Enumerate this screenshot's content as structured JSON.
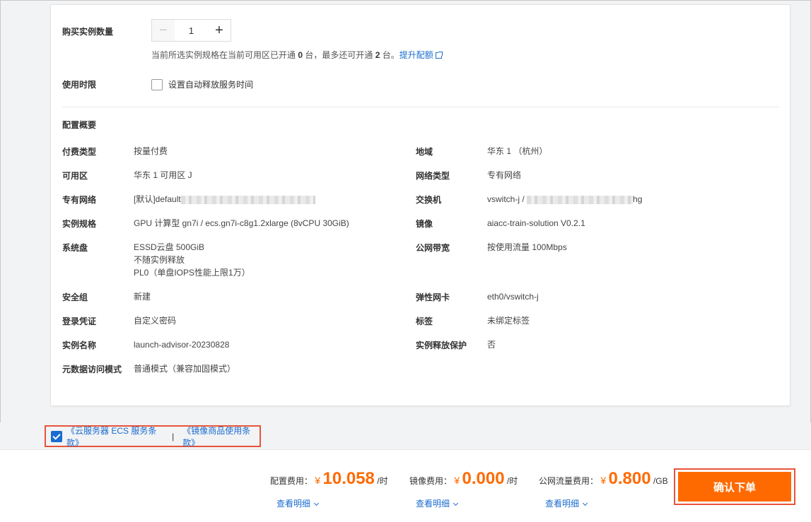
{
  "quantity": {
    "label": "购买实例数量",
    "minus": "−",
    "value": "1",
    "plus": "+",
    "hint_prefix": "当前所选实例规格在当前可用区已开通 ",
    "hint_count1": "0",
    "hint_mid": " 台，最多还可开通 ",
    "hint_count2": "2",
    "hint_suffix": " 台。",
    "hint_link": "提升配额"
  },
  "usage_time": {
    "label": "使用时限",
    "checkbox_label": "设置自动释放服务时间"
  },
  "summary": {
    "title": "配置概要",
    "pay_type": {
      "key": "付费类型",
      "value": "按量付费"
    },
    "region": {
      "key": "地域",
      "value": "华东 1 （杭州）"
    },
    "zone": {
      "key": "可用区",
      "value": "华东 1 可用区 J"
    },
    "network_type": {
      "key": "网络类型",
      "value": "专有网络"
    },
    "vpc": {
      "key": "专有网络",
      "value": "[默认]default"
    },
    "vswitch": {
      "key": "交换机",
      "value_prefix": "vswitch-j / ",
      "value_suffix": "hg"
    },
    "instance_type": {
      "key": "实例规格",
      "value": "GPU 计算型 gn7i / ecs.gn7i-c8g1.2xlarge (8vCPU 30GiB)"
    },
    "image": {
      "key": "镜像",
      "value": "aiacc-train-solution V0.2.1"
    },
    "system_disk": {
      "key": "系统盘",
      "line1": "ESSD云盘 500GiB",
      "line2": "不随实例释放",
      "line3": "PL0（单盘IOPS性能上限1万）"
    },
    "bandwidth": {
      "key": "公网带宽",
      "value": "按使用流量 100Mbps"
    },
    "security_group": {
      "key": "安全组",
      "value": "新建"
    },
    "eni": {
      "key": "弹性网卡",
      "value": "eth0/vswitch-j"
    },
    "login": {
      "key": "登录凭证",
      "value": "自定义密码"
    },
    "tags": {
      "key": "标签",
      "value": "未绑定标签"
    },
    "instance_name": {
      "key": "实例名称",
      "value": "launch-advisor-20230828"
    },
    "release_protect": {
      "key": "实例释放保护",
      "value": "否"
    },
    "metadata_mode": {
      "key": "元数据访问模式",
      "value": "普通模式（兼容加固模式）"
    }
  },
  "terms": {
    "ecs_terms": "《云服务器 ECS 服务条款》",
    "separator": "|",
    "image_terms": "《镜像商品使用条款》"
  },
  "footer": {
    "config_fee": {
      "label": "配置费用：",
      "currency": "¥",
      "amount": "10.058",
      "unit": "/时",
      "detail": "查看明细"
    },
    "image_fee": {
      "label": "镜像费用：",
      "currency": "¥",
      "amount": "0.000",
      "unit": "/时",
      "detail": "查看明细"
    },
    "traffic_fee": {
      "label": "公网流量费用：",
      "currency": "¥",
      "amount": "0.800",
      "unit": "/GB",
      "detail": "查看明细"
    },
    "confirm": "确认下单"
  },
  "colors": {
    "accent_orange": "#ff6a00",
    "link_blue": "#1a6ccf",
    "highlight_red": "#e8543a"
  }
}
